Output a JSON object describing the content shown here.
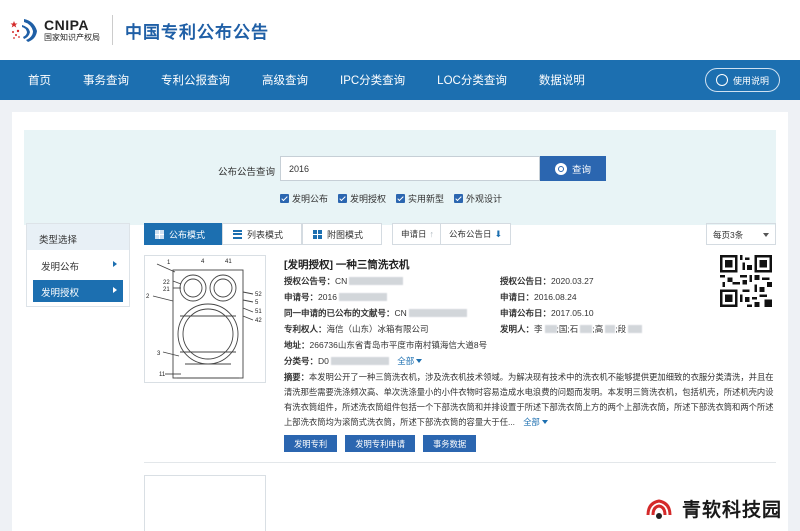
{
  "brand": {
    "logo_en": "CNIPA",
    "logo_cn": "国家知识产权局",
    "site_title": "中国专利公布公告"
  },
  "nav": {
    "items": [
      "首页",
      "事务查询",
      "专利公报查询",
      "高级查询",
      "IPC分类查询",
      "LOC分类查询",
      "数据说明"
    ],
    "help_label": "使用说明"
  },
  "search": {
    "label": "公布公告查询",
    "value": "2016",
    "button_label": "查询",
    "checkboxes": [
      {
        "label": "发明公布",
        "checked": true
      },
      {
        "label": "发明授权",
        "checked": true
      },
      {
        "label": "实用新型",
        "checked": true
      },
      {
        "label": "外观设计",
        "checked": true
      }
    ]
  },
  "sidebar": {
    "title": "类型选择",
    "items": [
      {
        "label": "发明公布",
        "active": false
      },
      {
        "label": "发明授权",
        "active": true
      }
    ]
  },
  "toolbar": {
    "modes": [
      "公布模式",
      "列表模式",
      "附图模式"
    ],
    "sort_apply": "申请日",
    "sort_pub": "公布公告日",
    "per_page": "每页3条"
  },
  "result": {
    "title": "[发明授权] 一种三筒洗衣机",
    "grant_no_label": "授权公告号：",
    "grant_no": "CN",
    "grant_date_label": "授权公告日：",
    "grant_date": "2020.03.27",
    "app_no_label": "申请号：",
    "app_no": "2016",
    "app_date_label": "申请日：",
    "app_date": "2016.08.24",
    "prior_label": "同一申请的已公布的文献号：",
    "prior": "CN",
    "pub_date_label": "申请公布日：",
    "pub_date": "2017.05.10",
    "owner_label": "专利权人：",
    "owner": "海信（山东）冰箱有限公司",
    "inventor_label": "发明人：",
    "inventor": "李",
    "inventor_parts": [
      "国",
      "石",
      "高",
      "段"
    ],
    "addr_label": "地址：",
    "addr": "266736山东省青岛市平度市南村镇海信大道8号",
    "class_label": "分类号：",
    "class": "D0",
    "more": "全部",
    "abstract_label": "摘要：",
    "abstract": "本发明公开了一种三筒洗衣机，涉及洗衣机技术领域。为解决现有技术中的洗衣机不能够提供更加细致的衣服分类清洗，并且在清洗那些需要洗涤频次高、单次洗涤量小的小件衣物时容易造成水电浪费的问题而发明。本发明三筒洗衣机，包括机壳，所述机壳内设有洗衣筒组件，所述洗衣筒组件包括一个下部洗衣筒和并排设置于所述下部洗衣筒上方的两个上部洗衣筒，所述下部洗衣筒和两个所述上部洗衣筒均为滚筒式洗衣筒，所述下部洗衣筒的容量大于任...",
    "abstract_more": "全部",
    "actions": [
      "发明专利",
      "发明专利申请",
      "事务数据"
    ],
    "figure_labels": [
      "1",
      "4",
      "41",
      "2",
      "22",
      "21",
      "52",
      "5",
      "51",
      "42",
      "3",
      "11"
    ]
  },
  "watermark": "青软科技园"
}
